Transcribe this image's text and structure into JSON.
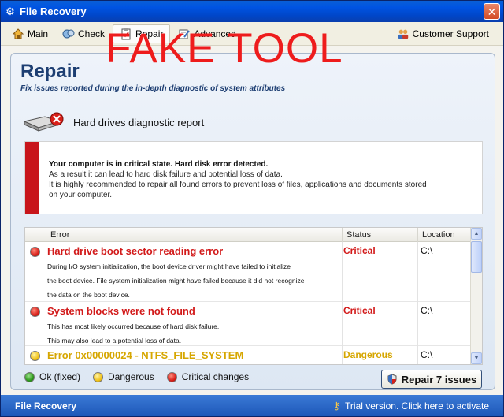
{
  "window": {
    "title": "File Recovery",
    "close_glyph": "✕"
  },
  "menu": {
    "items": [
      {
        "label": "Main",
        "icon": "home-icon"
      },
      {
        "label": "Check",
        "icon": "scan-icon"
      },
      {
        "label": "Repair",
        "icon": "clipboard-icon",
        "active": true
      },
      {
        "label": "Advanced",
        "icon": "tools-icon"
      }
    ],
    "support_label": "Customer Support"
  },
  "page": {
    "title": "Repair",
    "subtitle": "Fix issues reported during the in-depth diagnostic of system attributes",
    "stamp": "FAKE TOOL"
  },
  "diagnostic": {
    "title": "Hard drives diagnostic report"
  },
  "alert": {
    "heading": "Your computer is in critical state. Hard disk error detected.",
    "line1": "As a result it can lead to hard disk failure and potential loss of data.",
    "line2": "It is highly recommended to repair all found errors to prevent loss of files, applications and documents stored on your computer."
  },
  "table": {
    "headers": {
      "error": "Error",
      "status": "Status",
      "location": "Location"
    },
    "rows": [
      {
        "severity": "red",
        "title": "Hard drive boot sector reading error",
        "desc1": "During I/O system initialization, the boot device driver might have failed to initialize",
        "desc2": "the boot device. File system initialization might have failed because it did not recognize",
        "desc3": "the data on the boot device.",
        "status": "Critical",
        "location": "C:\\"
      },
      {
        "severity": "red",
        "title": "System blocks were not found",
        "desc1": "This has most likely occurred because of hard disk failure.",
        "desc2": "This may also lead to a potential loss of data.",
        "status": "Critical",
        "location": "C:\\"
      },
      {
        "severity": "yellow",
        "title": "Error 0x00000024 - NTFS_FILE_SYSTEM",
        "desc1": "",
        "status": "Dangerous",
        "location": "C:\\"
      }
    ]
  },
  "legend": {
    "ok": "Ok (fixed)",
    "dangerous": "Dangerous",
    "critical": "Critical changes"
  },
  "repair_button": {
    "label": "Repair 7 issues"
  },
  "footer": {
    "app_name": "File Recovery",
    "trial": "Trial version. Click here to activate"
  },
  "colors": {
    "critical": "#d21a1a",
    "dangerous": "#d6a600",
    "titlebar": "#0054e3",
    "stamp": "#ee1c1c"
  }
}
